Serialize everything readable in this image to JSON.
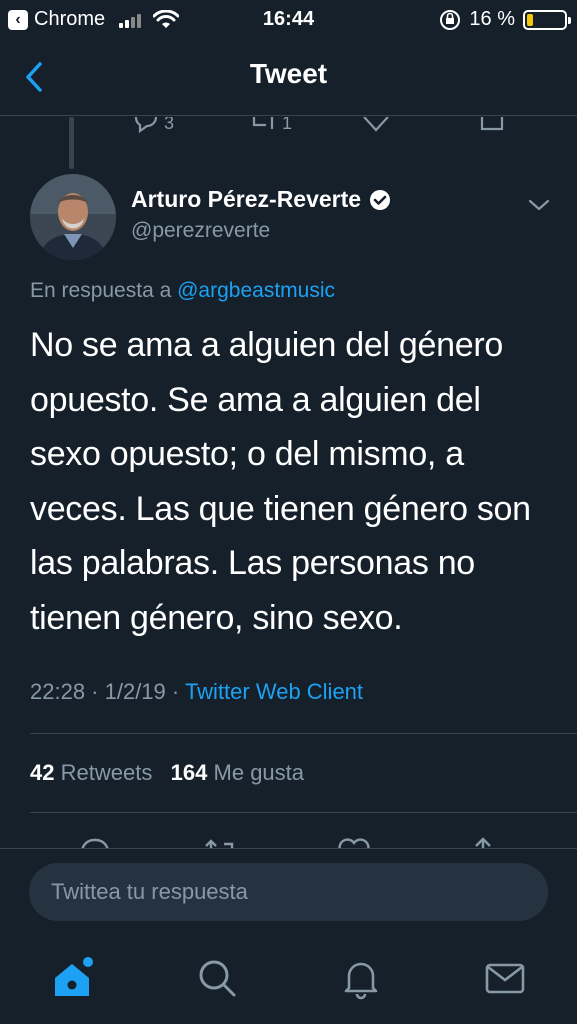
{
  "status_bar": {
    "back_app": "Chrome",
    "time": "16:44",
    "battery_percent": "16 %",
    "battery_level": 0.16
  },
  "header": {
    "title": "Tweet"
  },
  "prev_tweet_actions": {
    "reply_count": "3",
    "retweet_count": "1"
  },
  "tweet": {
    "author_name": "Arturo Pérez-Reverte",
    "verified": true,
    "handle": "@perezreverte",
    "reply_prefix": "En respuesta a",
    "reply_to": "@argbeastmusic",
    "text_lines": [
      "No se ama a alguien del género",
      "opuesto. Se ama a alguien del",
      "sexo opuesto; o del mismo, a",
      "veces. Las que tienen género son",
      "las palabras. Las personas no",
      "tienen género, sino sexo."
    ],
    "timestamp": "22:28 · 1/2/19 ·",
    "source": "Twitter Web Client",
    "retweets_count": "42",
    "retweets_label": "Retweets",
    "likes_count": "164",
    "likes_label": "Me gusta"
  },
  "composer": {
    "placeholder": "Twittea tu respuesta"
  },
  "tabbar": {
    "items": [
      "home-icon",
      "search-icon",
      "bell-icon",
      "mail-icon"
    ],
    "active_color": "#1da1f2"
  },
  "colors": {
    "background": "#15202b",
    "accent": "#1da1f2",
    "secondary_text": "#8899a6",
    "divider": "#38444d"
  }
}
